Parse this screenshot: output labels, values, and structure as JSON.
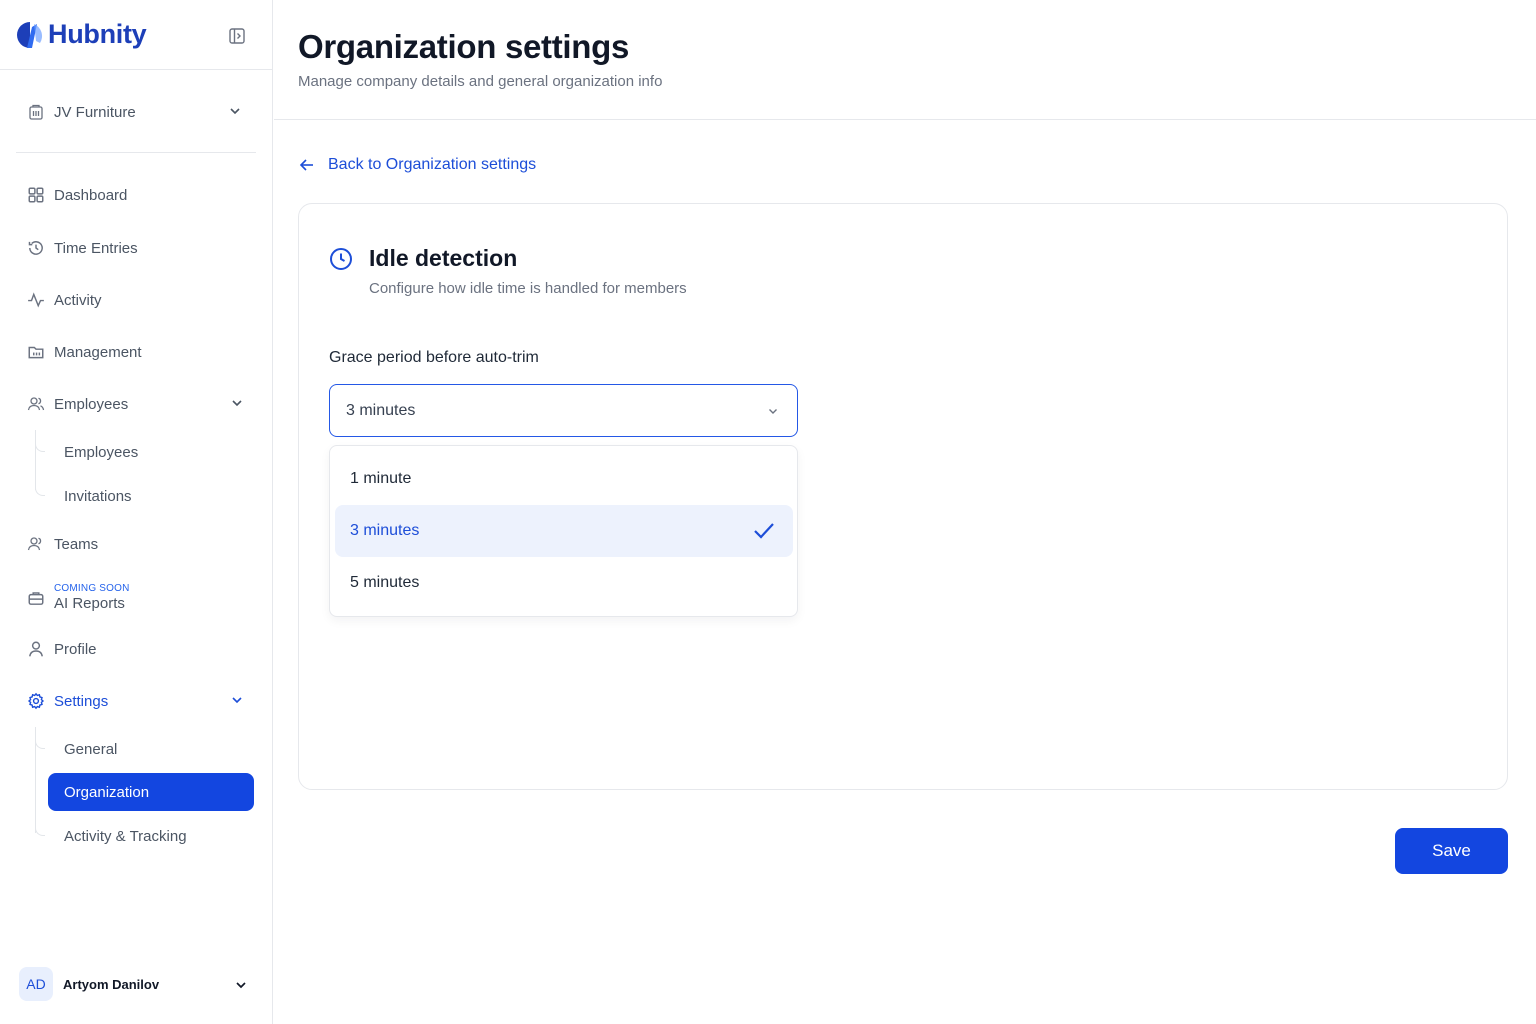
{
  "brand": {
    "name": "Hubnity",
    "color": "#1d3fb8"
  },
  "sidebar": {
    "org_name": "JV Furniture",
    "nav": {
      "dashboard": "Dashboard",
      "time_entries": "Time Entries",
      "activity": "Activity",
      "management": "Management",
      "employees": "Employees",
      "teams": "Teams",
      "ai_badge": "COMING SOON",
      "ai_reports": "AI Reports",
      "profile": "Profile",
      "settings": "Settings"
    },
    "employees_sub": [
      "Employees",
      "Invitations"
    ],
    "settings_sub": [
      "General",
      "Organization",
      "Activity & Tracking"
    ],
    "user": {
      "initials": "AD",
      "name": "Artyom Danilov"
    }
  },
  "header": {
    "title": "Organization settings",
    "subtitle": "Manage company details and general organization info"
  },
  "back_link": "Back to Organization settings",
  "card": {
    "title": "Idle detection",
    "subtitle": "Configure how idle time is handled for members",
    "field_label": "Grace period before auto-trim",
    "selected_value": "3 minutes",
    "options": [
      "1 minute",
      "3 minutes",
      "5 minutes"
    ]
  },
  "save_label": "Save",
  "colors": {
    "accent": "#1346e0",
    "selected_bg": "#edf2fd"
  }
}
